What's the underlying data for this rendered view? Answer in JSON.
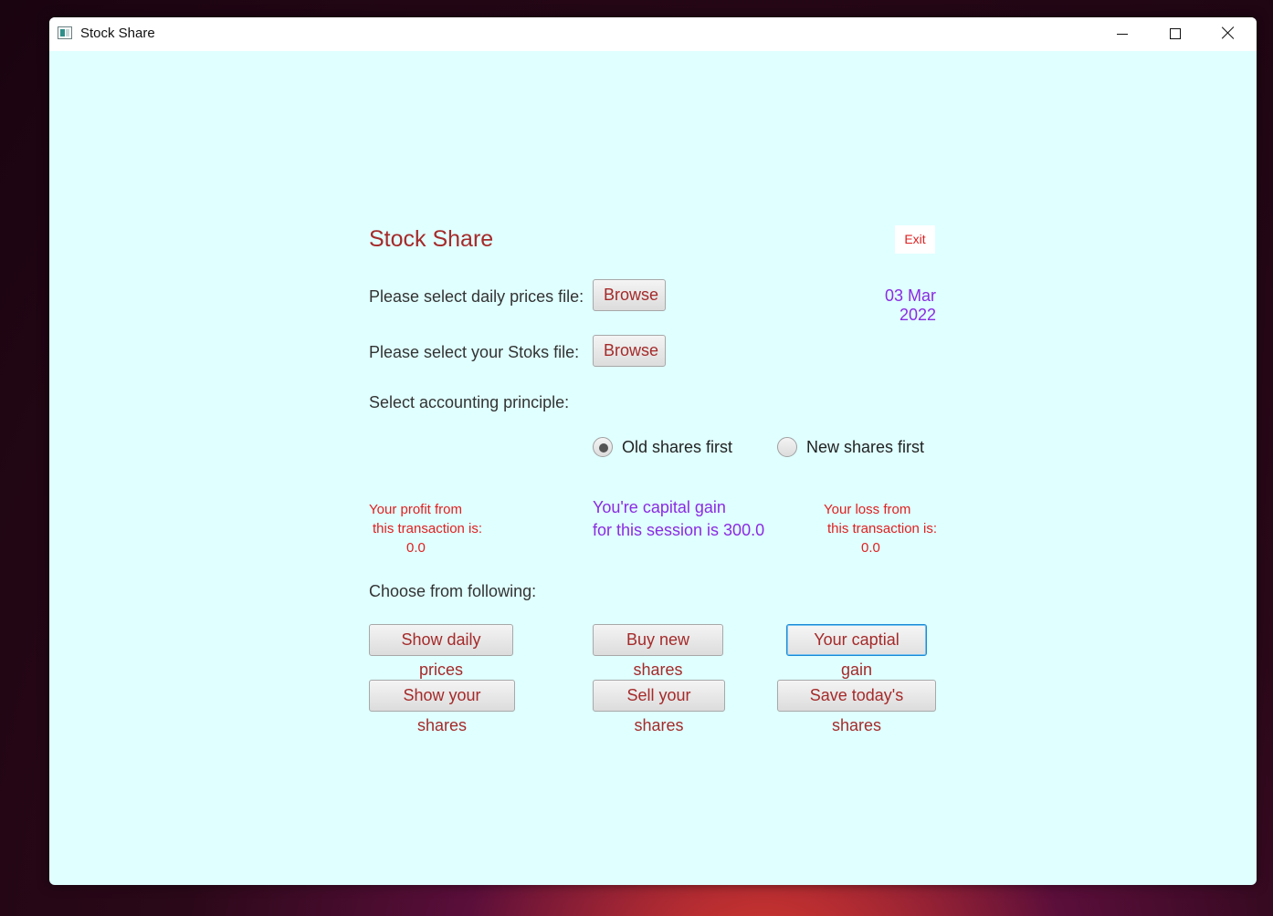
{
  "window": {
    "title": "Stock Share",
    "controls": {
      "minimize": "minimize",
      "maximize": "maximize",
      "close": "close"
    }
  },
  "header": {
    "title": "Stock Share",
    "exit_label": "Exit"
  },
  "files": {
    "daily_prices_label": "Please select daily prices file:",
    "daily_prices_button": "Browse",
    "stocks_label": "Please select your Stoks file:",
    "stocks_button": "Browse",
    "date": "03 Mar 2022"
  },
  "accounting": {
    "label": "Select accounting principle:",
    "options": [
      {
        "label": "Old shares first",
        "selected": true
      },
      {
        "label": "New shares first",
        "selected": false
      }
    ]
  },
  "results": {
    "profit_line1": "Your profit from",
    "profit_line2": "this transaction is:",
    "profit_value": "0.0",
    "capital_line1": "You're capital gain",
    "capital_line2": "for this session is 300.0",
    "loss_line1": "Your loss from",
    "loss_line2": "this transaction is:",
    "loss_value": "0.0"
  },
  "actions": {
    "label": "Choose from following:",
    "show_daily_prices": "Show daily prices",
    "buy_new_shares": "Buy new shares",
    "your_capital_gain": "Your captial gain",
    "show_your_shares": "Show your shares",
    "sell_your_shares": "Sell your shares",
    "save_todays_shares": "Save today's shares"
  },
  "colors": {
    "background": "#e0ffff",
    "accent_red": "#a52a2a",
    "accent_purple": "#8a2be2",
    "alert_red": "#e02020"
  }
}
